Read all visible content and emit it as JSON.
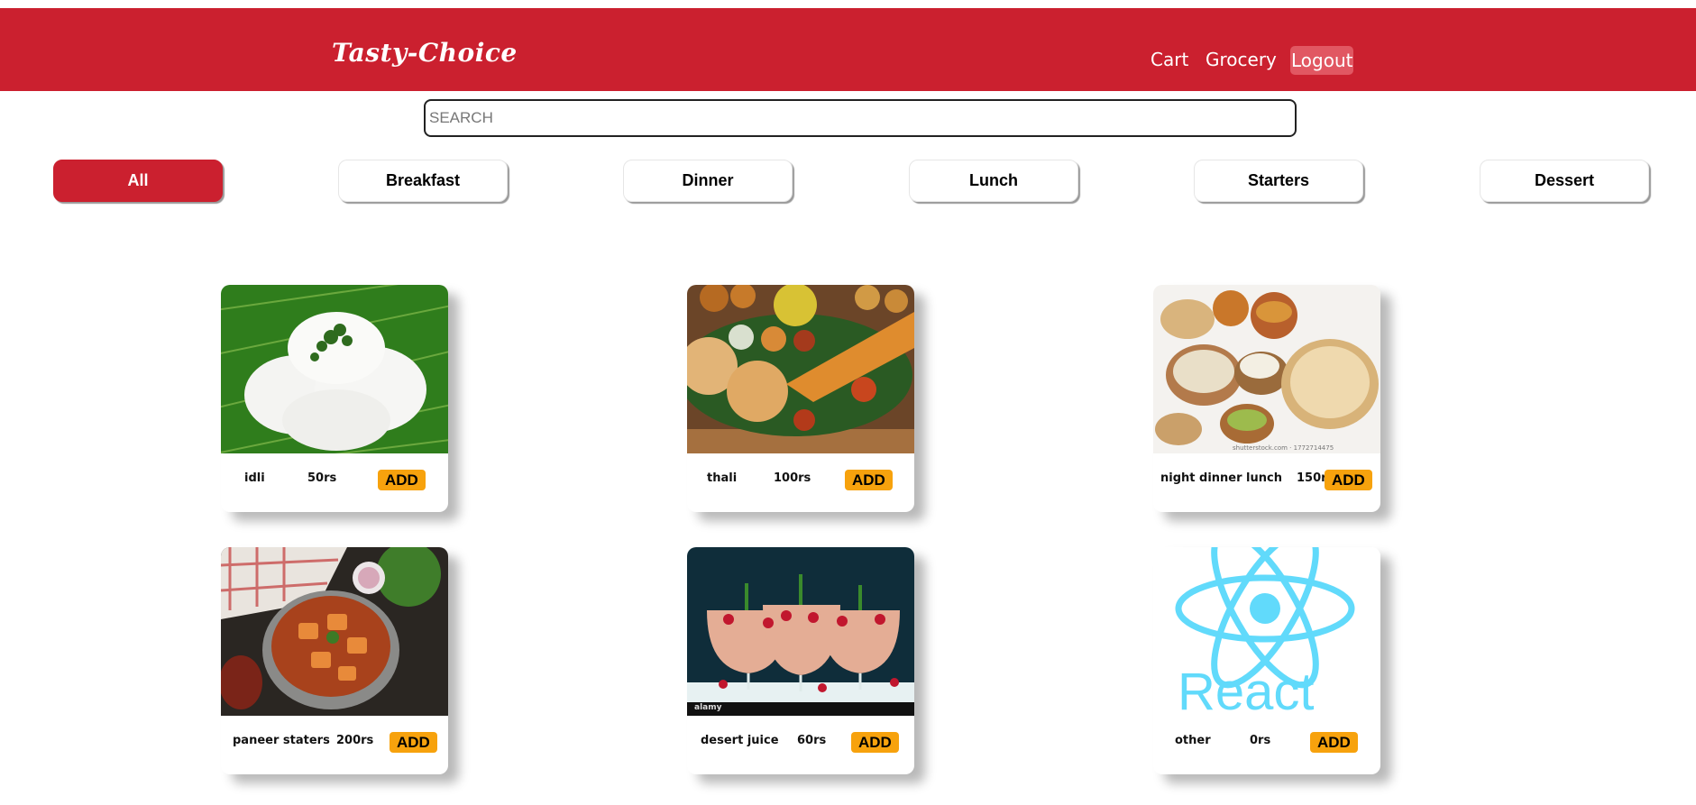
{
  "header": {
    "brand": "Tasty-Choice",
    "nav": {
      "cart": "Cart",
      "grocery": "Grocery",
      "logout": "Logout"
    }
  },
  "search": {
    "placeholder": "SEARCH",
    "value": ""
  },
  "filters": [
    {
      "label": "All",
      "active": true
    },
    {
      "label": "Breakfast",
      "active": false
    },
    {
      "label": "Dinner",
      "active": false
    },
    {
      "label": "Lunch",
      "active": false
    },
    {
      "label": "Starters",
      "active": false
    },
    {
      "label": "Dessert",
      "active": false
    }
  ],
  "items": [
    {
      "name": "idli",
      "price": "50rs",
      "add": "ADD",
      "image": "idli-photo"
    },
    {
      "name": "thali",
      "price": "100rs",
      "add": "ADD",
      "image": "thali-photo"
    },
    {
      "name": "night dinner lunch",
      "price": "150rs",
      "add": "ADD",
      "image": "dinner-spread-photo",
      "watermark": "shutterstock.com · 1772714475"
    },
    {
      "name": "paneer staters",
      "price": "200rs",
      "add": "ADD",
      "image": "paneer-curry-photo"
    },
    {
      "name": "desert juice",
      "price": "60rs",
      "add": "ADD",
      "image": "juice-glasses-photo",
      "watermark": "alamy"
    },
    {
      "name": "other",
      "price": "0rs",
      "add": "ADD",
      "image": "react-logo",
      "logo_text": "React"
    }
  ],
  "colors": {
    "primary": "#cb202f",
    "accent": "#f7a20d",
    "react": "#61dafb"
  }
}
